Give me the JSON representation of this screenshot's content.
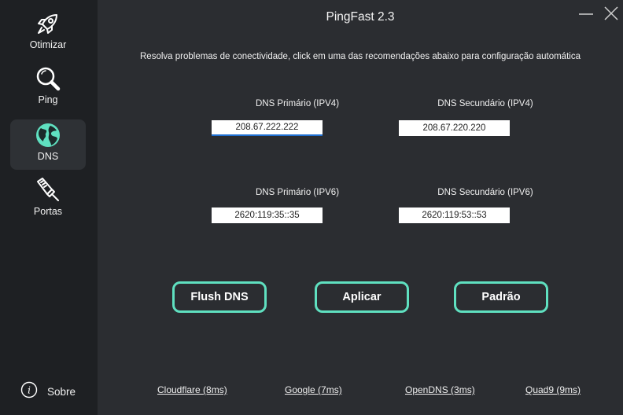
{
  "app": {
    "title": "PingFast 2.3"
  },
  "colors": {
    "accent": "#5fe0c0",
    "sidebar_bg": "#1e2023",
    "main_bg": "#2b2d31",
    "active_nav_bg": "#2e3135"
  },
  "sidebar": {
    "items": [
      {
        "label": "Otimizar",
        "icon": "rocket-icon",
        "active": false
      },
      {
        "label": "Ping",
        "icon": "magnifier-icon",
        "active": false
      },
      {
        "label": "DNS",
        "icon": "globe-icon",
        "active": true
      },
      {
        "label": "Portas",
        "icon": "ethernet-cable-icon",
        "active": false
      }
    ],
    "about": {
      "label": "Sobre",
      "icon": "info-icon"
    }
  },
  "main": {
    "subtitle": "Resolva problemas de conectividade, click em uma das recomendações abaixo para configuração automática",
    "ipv4": {
      "primary_label": "DNS Primário (IPV4)",
      "primary_value": "208.67.222.222",
      "secondary_label": "DNS Secundário (IPV4)",
      "secondary_value": "208.67.220.220"
    },
    "ipv6": {
      "primary_label": "DNS Primário (IPV6)",
      "primary_value": "2620:119:35::35",
      "secondary_label": "DNS Secundário (IPV6)",
      "secondary_value": "2620:119:53::53"
    },
    "buttons": {
      "flush": "Flush DNS",
      "apply": "Aplicar",
      "default": "Padrão"
    },
    "presets": [
      "Cloudflare (8ms)",
      "Google (7ms)",
      "OpenDNS (3ms)",
      "Quad9 (9ms)"
    ]
  }
}
